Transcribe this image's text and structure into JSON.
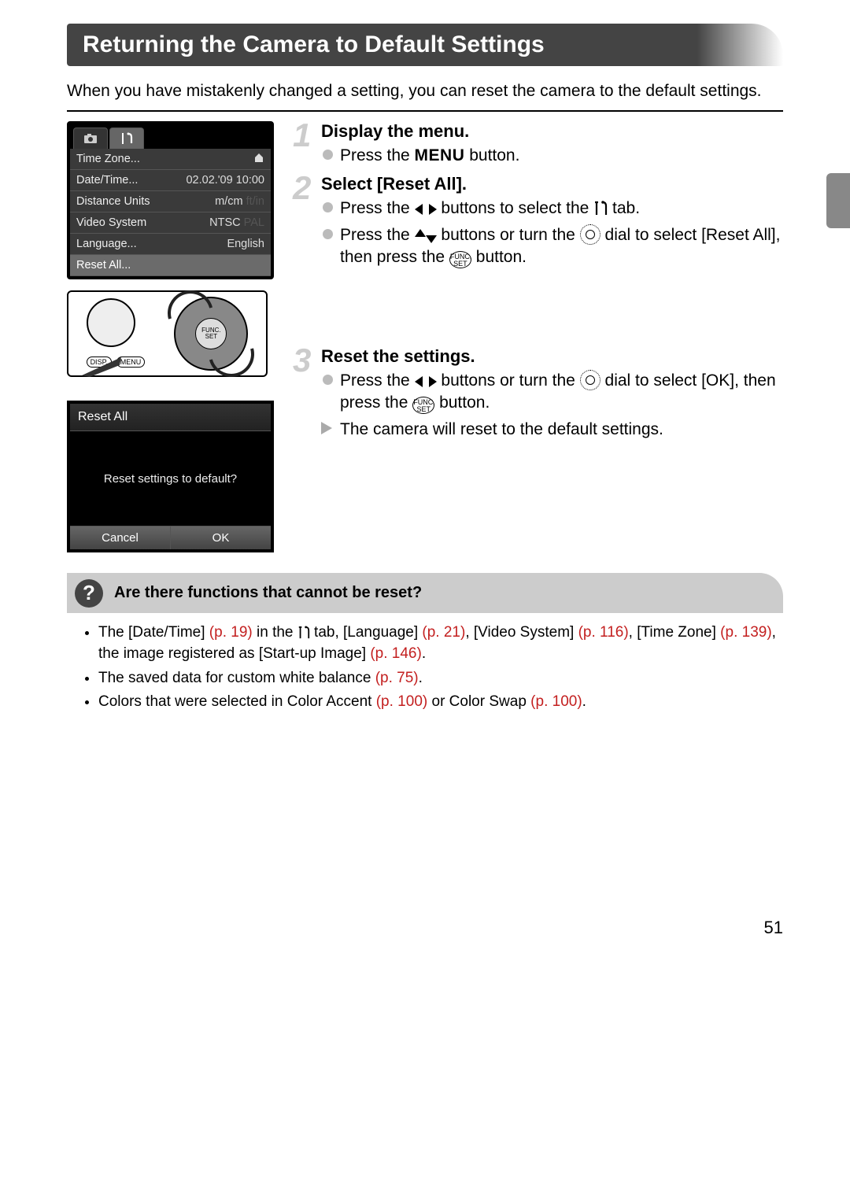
{
  "title": "Returning the Camera to Default Settings",
  "intro": "When you have mistakenly changed a setting, you can reset the camera to the default settings.",
  "menu_screen": {
    "rows": [
      {
        "label": "Time Zone...",
        "value": "",
        "home_icon": true
      },
      {
        "label": "Date/Time...",
        "value": "02.02.'09 10:00"
      },
      {
        "label": "Distance Units",
        "value": "m/cm",
        "dim": "ft/in"
      },
      {
        "label": "Video System",
        "value": "NTSC",
        "dim": "PAL"
      },
      {
        "label": "Language...",
        "value": "English"
      },
      {
        "label": "Reset All...",
        "value": "",
        "selected": true
      }
    ]
  },
  "dialog": {
    "title": "Reset All",
    "message": "Reset settings to default?",
    "cancel": "Cancel",
    "ok": "OK"
  },
  "controls": {
    "disp": "DISP.",
    "menu": "MENU",
    "func": "FUNC.\nSET"
  },
  "steps": {
    "s1": {
      "num": "1",
      "title": "Display the menu.",
      "line1_a": "Press the ",
      "line1_menu": "MENU",
      "line1_b": " button."
    },
    "s2": {
      "num": "2",
      "title": "Select [Reset All].",
      "line1_a": "Press the ",
      "line1_b": " buttons to select the ",
      "line1_c": " tab.",
      "line2_a": "Press the ",
      "line2_b": " buttons or turn the ",
      "line2_c": " dial to select [Reset All], then press the ",
      "line2_d": " button."
    },
    "s3": {
      "num": "3",
      "title": "Reset the settings.",
      "line1_a": "Press the ",
      "line1_b": " buttons or turn the ",
      "line1_c": " dial to select [OK], then press the ",
      "line1_d": " button.",
      "line2": "The camera will reset to the default settings."
    }
  },
  "q_title": "Are there functions that cannot be reset?",
  "notes": {
    "n1_a": "The [Date/Time] ",
    "n1_p1": "(p. 19)",
    "n1_b": " in the ",
    "n1_c": " tab, [Language] ",
    "n1_p2": "(p. 21)",
    "n1_d": ", [Video System] ",
    "n1_p3": "(p. 116)",
    "n1_e": ", [Time Zone] ",
    "n1_p4": "(p. 139)",
    "n1_f": ", the image registered as [Start-up Image] ",
    "n1_p5": "(p. 146)",
    "n1_g": ".",
    "n2_a": "The saved data for custom white balance ",
    "n2_p": "(p. 75)",
    "n2_b": ".",
    "n3_a": "Colors that were selected in Color Accent ",
    "n3_p1": "(p. 100)",
    "n3_b": " or Color Swap ",
    "n3_p2": "(p. 100)",
    "n3_c": "."
  },
  "page_number": "51"
}
